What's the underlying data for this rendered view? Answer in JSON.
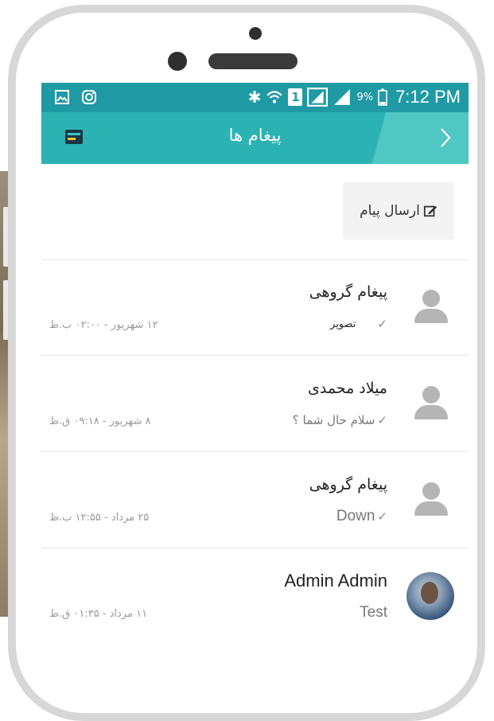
{
  "status_bar": {
    "left_icons": [
      "gallery-icon",
      "instagram-icon"
    ],
    "right_icons": [
      "bluetooth-icon",
      "wifi-icon",
      "sim-icon",
      "signal-icon",
      "signal-icon"
    ],
    "sim_label": "1",
    "battery_percent": "9%",
    "time": "7:12 PM"
  },
  "app_bar": {
    "title": "پیغام ها",
    "back_glyph": "‹"
  },
  "compose": {
    "label": "ارسال پیام",
    "icon": "edit-icon"
  },
  "messages": [
    {
      "name": "پیغام گروهی",
      "preview": "تصویر",
      "date": "۱۲ شهریور - ۰۲:۰۰ ب.ظ",
      "avatar": "default"
    },
    {
      "name": "میلاد محمدی",
      "preview": "سلام حال شما ؟",
      "date": "۸ شهریور - ۰۹:۱۸ ق.ظ",
      "avatar": "default"
    },
    {
      "name": "پیغام گروهی",
      "preview": "Down",
      "date": "۲۵ مرداد - ۱۲:۵۵ ب.ظ",
      "avatar": "default"
    },
    {
      "name": "Admin Admin",
      "preview": "Test",
      "date": "۱۱ مرداد - ۰۱:۳۵ ق.ظ",
      "avatar": "photo"
    }
  ],
  "colors": {
    "status_bar": "#1f9aa4",
    "app_bar": "#2bb3b4",
    "app_bar_accent": "#4fc7c2",
    "phone_frame": "#d7d7d7",
    "avatar_default": "#b5b5b5"
  }
}
